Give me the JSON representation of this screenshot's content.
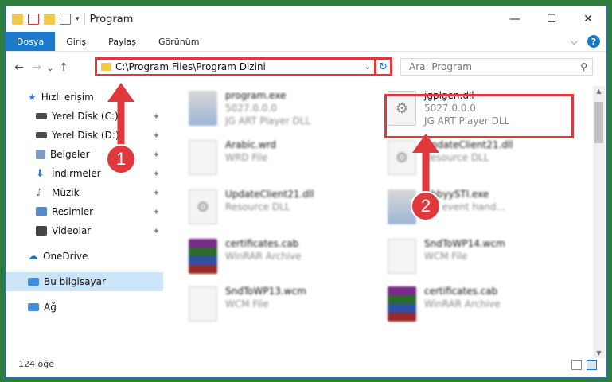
{
  "window": {
    "title": "Program",
    "controls": {
      "minimize": "—",
      "maximize": "☐",
      "close": "✕"
    }
  },
  "ribbon": {
    "tabs": [
      "Dosya",
      "Giriş",
      "Paylaş",
      "Görünüm"
    ],
    "active_tab": "Dosya",
    "expand": "⌵",
    "help": "?"
  },
  "nav": {
    "back": "←",
    "forward": "→",
    "recent": "⌄",
    "up": "↑",
    "address": "C:\\Program Files\\Program Dizini",
    "address_chevron": "⌄",
    "refresh": "↻",
    "search_placeholder": "Ara: Program",
    "search_icon": "⚲"
  },
  "sidebar": {
    "quick_access": "Hızlı erişim",
    "items": [
      {
        "label": "Yerel Disk (C:)",
        "icon": "drive-icon",
        "color": "#4a4a4a"
      },
      {
        "label": "Yerel Disk (D:)",
        "icon": "drive-icon",
        "color": "#4a4a4a"
      },
      {
        "label": "Belgeler",
        "icon": "documents-icon",
        "color": "#7a9cc6"
      },
      {
        "label": "İndirmeler",
        "icon": "download-icon",
        "color": "#2f7bd1"
      },
      {
        "label": "Müzik",
        "icon": "music-icon",
        "color": "#2f7bd1"
      },
      {
        "label": "Resimler",
        "icon": "pictures-icon",
        "color": "#5a8ac6"
      },
      {
        "label": "Videolar",
        "icon": "videos-icon",
        "color": "#444444"
      }
    ],
    "pin": "📌",
    "onedrive": "OneDrive",
    "this_pc": "Bu bilgisayar",
    "network": "Ağ"
  },
  "files": [
    {
      "name": "program.exe",
      "line2": "5027.0.0.0",
      "line3": "JG ART Player DLL",
      "icon": "exe-icon"
    },
    {
      "name": "jgplgen.dll",
      "line2": "5027.0.0.0",
      "line3": "JG ART Player DLL",
      "icon": "dll-gear-icon"
    },
    {
      "name": "Arabic.wrd",
      "line2": "WRD File",
      "line3": "",
      "icon": "file-icon"
    },
    {
      "name": "UpdateClient21.dll",
      "line2": "Resource DLL",
      "line3": "",
      "icon": "dll-gear-icon"
    },
    {
      "name": "UpdateClient21.dll",
      "line2": "Resource DLL",
      "line3": "",
      "icon": "dll-gear-icon"
    },
    {
      "name": "AbbyySTI.exe",
      "line2": "STI event hand...",
      "line3": "",
      "icon": "exe-icon"
    },
    {
      "name": "certificates.cab",
      "line2": "WinRAR Archive",
      "line3": "",
      "icon": "winrar-icon"
    },
    {
      "name": "SndToWP14.wcm",
      "line2": "WCM File",
      "line3": "",
      "icon": "file-icon"
    },
    {
      "name": "SndToWP13.wcm",
      "line2": "WCM File",
      "line3": "",
      "icon": "file-icon"
    },
    {
      "name": "certificates.cab",
      "line2": "WinRAR Archive",
      "line3": "",
      "icon": "winrar-icon"
    }
  ],
  "status": {
    "count": "124 öğe"
  },
  "markers": {
    "one": "1",
    "two": "2"
  },
  "colors": {
    "accent": "#1979ca",
    "highlight": "#e0383c",
    "selection": "#cce4f7"
  }
}
